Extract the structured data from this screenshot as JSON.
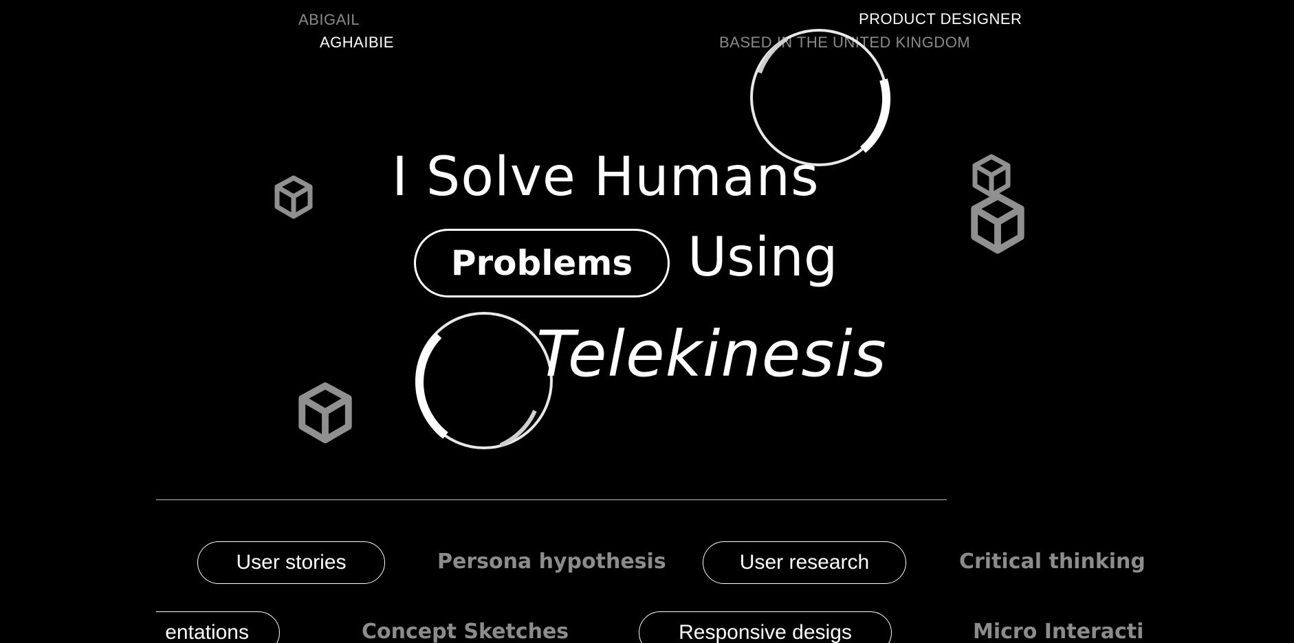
{
  "header": {
    "first_name": "ABIGAIL",
    "last_name": "AGHAIBIE",
    "role": "PRODUCT DESIGNER",
    "location": "BASED IN THE UNITED KINGDOM"
  },
  "hero": {
    "line1": "I Solve Humans",
    "highlight": "Problems",
    "line2": "Using",
    "line3": "Telekinesis"
  },
  "skills_row1": [
    "User stories",
    "Persona hypothesis",
    "User research",
    "Critical thinking"
  ],
  "skills_row2": [
    "entations",
    "Concept Sketches",
    "Responsive desigs",
    "Micro Interacti"
  ],
  "icons": [
    "cube-icon",
    "ring-decoration"
  ],
  "colors": {
    "background": "#000000",
    "text": "#ffffff",
    "muted": "#8a8a8a",
    "icon": "#909090"
  }
}
